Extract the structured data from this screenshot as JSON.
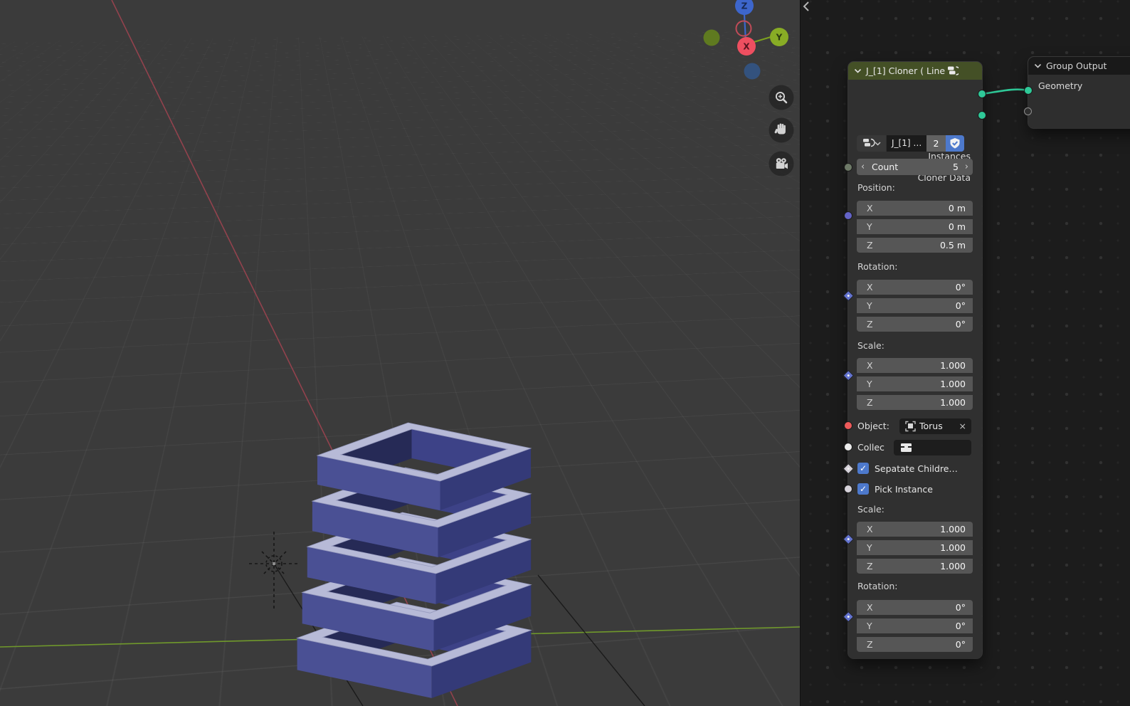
{
  "viewport": {
    "axis_gizmo": {
      "x_label": "X",
      "y_label": "Y",
      "z_label": "Z"
    },
    "nav_buttons": [
      {
        "name": "zoom-tool-button",
        "icon": "magnifier-plus-icon"
      },
      {
        "name": "pan-tool-button",
        "icon": "hand-icon"
      },
      {
        "name": "camera-view-button",
        "icon": "movie-camera-icon"
      }
    ],
    "colors": {
      "background": "#3b3b3b",
      "axis_x": "#9d4450",
      "axis_y": "#739f2b",
      "gizmo_x": "#ee4f60",
      "gizmo_y": "#88ac25",
      "gizmo_z": "#3d66cc",
      "gizmo_neg_y": "#5f7a20",
      "gizmo_neg_z": "#33527e",
      "object_top": "#b7bad7",
      "object_left": "#4a5094",
      "object_right": "#343a78",
      "object_inner_left": "#3d4287",
      "object_inner_right": "#262a56",
      "object_edge": "#9599bd"
    }
  },
  "node_editor": {
    "cloner_node": {
      "title": "J_[1] Cloner ( Line",
      "outputs": [
        {
          "label": "Instances"
        },
        {
          "label": "Cloner Data"
        }
      ],
      "datablock": {
        "name": "J_[1] …",
        "users": "2"
      },
      "count": {
        "label": "Count",
        "value": "5"
      },
      "position": {
        "label": "Position:",
        "x_axis": "X",
        "x": "0 m",
        "y_axis": "Y",
        "y": "0 m",
        "z_axis": "Z",
        "z": "0.5 m"
      },
      "rotation": {
        "label": "Rotation:",
        "x_axis": "X",
        "x": "0°",
        "y_axis": "Y",
        "y": "0°",
        "z_axis": "Z",
        "z": "0°"
      },
      "scale": {
        "label": "Scale:",
        "x_axis": "X",
        "x": "1.000",
        "y_axis": "Y",
        "y": "1.000",
        "z_axis": "Z",
        "z": "1.000"
      },
      "object_field": {
        "label": "Object:",
        "value": "Torus",
        "clear": "×"
      },
      "collection_field": {
        "label": "Collec"
      },
      "separate_children": {
        "label": "Sepatate Childre…",
        "checked": true
      },
      "pick_instance": {
        "label": "Pick Instance",
        "checked": true
      },
      "instance_scale": {
        "label": "Scale:",
        "x_axis": "X",
        "x": "1.000",
        "y_axis": "Y",
        "y": "1.000",
        "z_axis": "Z",
        "z": "1.000"
      },
      "instance_rotation": {
        "label": "Rotation:",
        "x_axis": "X",
        "x": "0°",
        "y_axis": "Y",
        "y": "0°",
        "z_axis": "Z",
        "z": "0°"
      }
    },
    "group_output_node": {
      "title": "Group Output",
      "input_label": "Geometry"
    },
    "slider_arrows": {
      "left": "‹",
      "right": "›"
    },
    "colors": {
      "header_green": "#445026",
      "wire": "#2fc998",
      "socket_geometry": "#2fc998",
      "socket_integer": "#6e7a68",
      "socket_vector": "#6363c7",
      "socket_rotation": "#6474d0",
      "socket_object": "#ed5a5a",
      "socket_collection": "#ececec",
      "socket_boolean": "#d6d2da",
      "checkbox_blue": "#4d79cc"
    }
  }
}
